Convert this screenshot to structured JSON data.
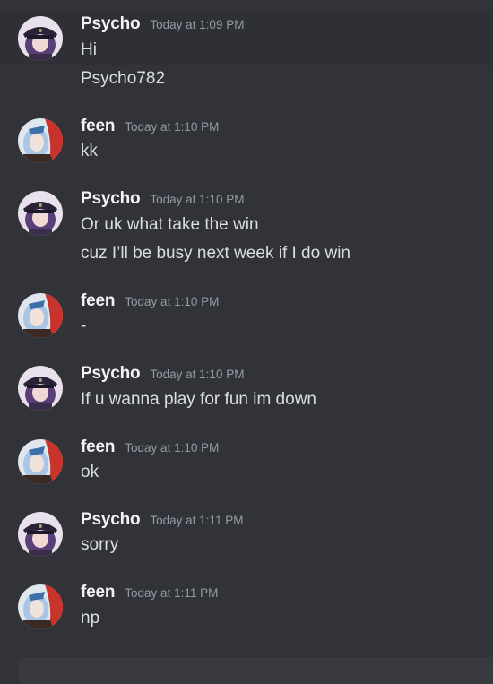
{
  "messages": [
    {
      "author": "Psycho",
      "avatar": "psycho-avatar",
      "timestamp": "Today at 1:09 PM",
      "lines": [
        "Hi",
        "Psycho782"
      ]
    },
    {
      "author": "feen",
      "avatar": "feen-avatar",
      "timestamp": "Today at 1:10 PM",
      "lines": [
        "kk"
      ]
    },
    {
      "author": "Psycho",
      "avatar": "psycho-avatar",
      "timestamp": "Today at 1:10 PM",
      "lines": [
        "Or uk what take the win",
        "cuz I’ll be busy next week if I do win"
      ]
    },
    {
      "author": "feen",
      "avatar": "feen-avatar",
      "timestamp": "Today at 1:10 PM",
      "lines": [
        "-"
      ]
    },
    {
      "author": "Psycho",
      "avatar": "psycho-avatar",
      "timestamp": "Today at 1:10 PM",
      "lines": [
        "If u wanna play for fun im down"
      ]
    },
    {
      "author": "feen",
      "avatar": "feen-avatar",
      "timestamp": "Today at 1:10 PM",
      "lines": [
        "ok"
      ]
    },
    {
      "author": "Psycho",
      "avatar": "psycho-avatar",
      "timestamp": "Today at 1:11 PM",
      "lines": [
        "sorry"
      ]
    },
    {
      "author": "feen",
      "avatar": "feen-avatar",
      "timestamp": "Today at 1:11 PM",
      "lines": [
        "np"
      ]
    }
  ],
  "colors": {
    "background": "#313338",
    "hover_background": "#2e3035",
    "username": "#f2f3f5",
    "timestamp": "#949ba4",
    "message_text": "#dbdee1"
  }
}
